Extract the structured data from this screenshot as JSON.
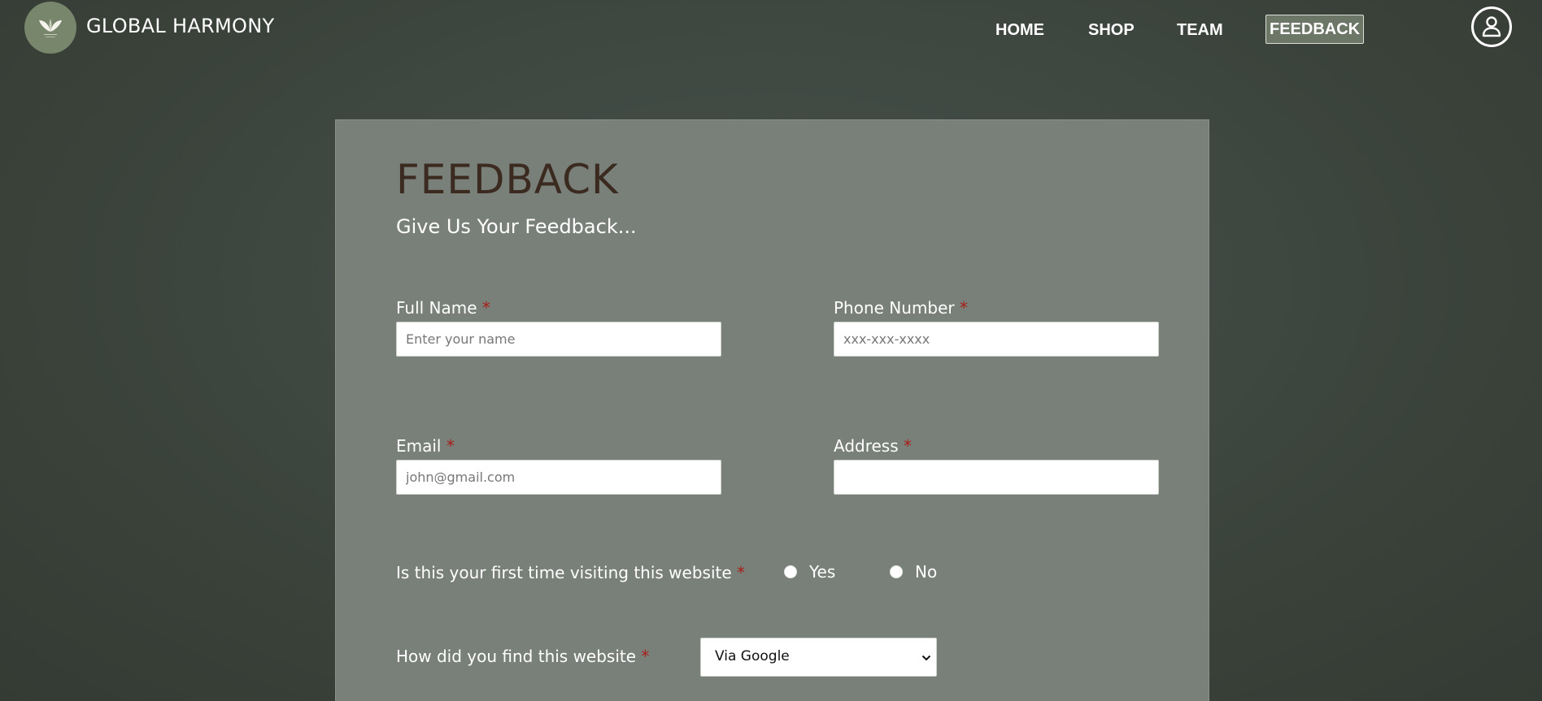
{
  "header": {
    "brand": "GLOBAL HARMONY",
    "nav": [
      {
        "label": "HOME"
      },
      {
        "label": "SHOP"
      },
      {
        "label": "TEAM"
      },
      {
        "label": "FEEDBACK",
        "active": true
      }
    ]
  },
  "form": {
    "title": "FEEDBACK",
    "subtitle": "Give Us Your Feedback...",
    "required_mark": "*",
    "full_name": {
      "label": "Full Name",
      "placeholder": "Enter your name",
      "value": ""
    },
    "phone": {
      "label": "Phone Number",
      "placeholder": "xxx-xxx-xxxx",
      "value": ""
    },
    "email": {
      "label": "Email",
      "placeholder": "john@gmail.com",
      "value": ""
    },
    "address": {
      "label": "Address",
      "placeholder": "",
      "value": ""
    },
    "first_time": {
      "label": "Is this your first time visiting this website",
      "options": [
        "Yes",
        "No"
      ]
    },
    "source": {
      "label": "How did you find this website",
      "selected": "Via Google"
    }
  },
  "colors": {
    "background": "#3e4841",
    "card": "#798079",
    "title": "#3b2a1f",
    "required": "#a8201a",
    "logo": "#78866b"
  },
  "icons": {
    "logo": "leaf-logo-icon",
    "profile": "user-profile-icon",
    "select_chevron": "chevron-down-icon"
  }
}
